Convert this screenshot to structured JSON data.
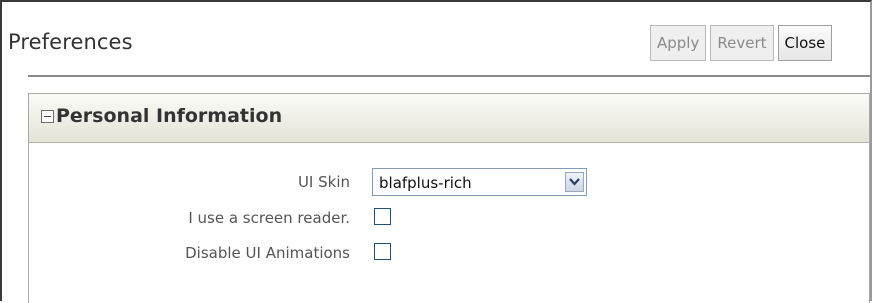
{
  "header": {
    "title": "Preferences",
    "buttons": {
      "apply": "Apply",
      "revert": "Revert",
      "close": "Close"
    }
  },
  "panel": {
    "title": "Personal Information",
    "collapse_icon": "collapse-icon",
    "fields": {
      "ui_skin": {
        "label": "UI Skin",
        "value": "blafplus-rich"
      },
      "screen_reader": {
        "label": "I use a screen reader.",
        "checked": false
      },
      "disable_animations": {
        "label": "Disable UI Animations",
        "checked": false
      }
    }
  }
}
